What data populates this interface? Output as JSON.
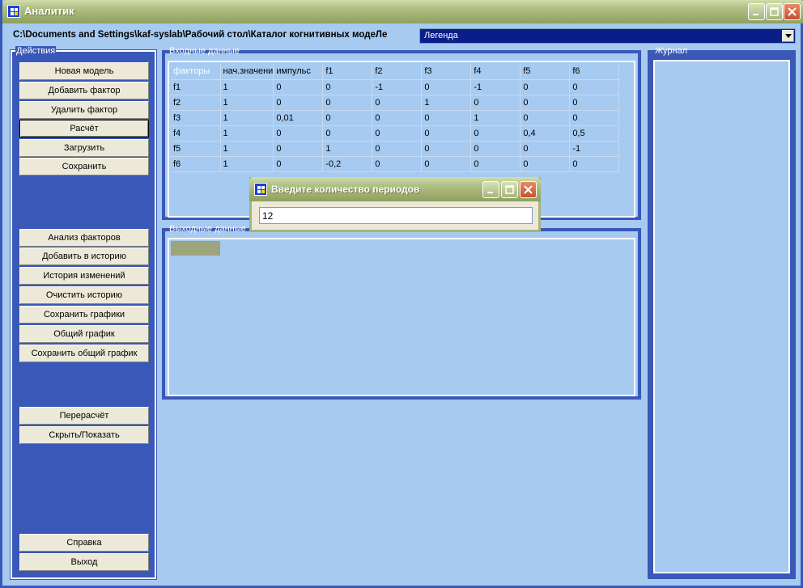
{
  "window": {
    "title": "Аналитик"
  },
  "path_bar": {
    "path": "C:\\Documents and Settings\\kaf-syslab\\Рабочий стол\\Каталог когнитивных модеЛе",
    "legend_value": "Легенда"
  },
  "actions": {
    "label": "Действия",
    "buttons": [
      "Новая модель",
      "Добавить фактор",
      "Удалить фактор",
      "Расчёт",
      "Загрузить",
      "Сохранить",
      "Анализ факторов",
      "Добавить в историю",
      "История изменений",
      "Очистить историю",
      "Сохранить графики",
      "Общий график",
      "Сохранить общий график",
      "Перерасчёт",
      "Скрыть/Показать",
      "Справка",
      "Выход"
    ]
  },
  "input_data": {
    "label": "Входные данные",
    "headers": [
      "факторы",
      "нач.значени",
      "импульс",
      "f1",
      "f2",
      "f3",
      "f4",
      "f5",
      "f6"
    ],
    "rows": [
      [
        "f1",
        "1",
        "0",
        "0",
        "-1",
        "0",
        "-1",
        "0",
        "0"
      ],
      [
        "f2",
        "1",
        "0",
        "0",
        "0",
        "1",
        "0",
        "0",
        "0"
      ],
      [
        "f3",
        "1",
        "0,01",
        "0",
        "0",
        "0",
        "1",
        "0",
        "0"
      ],
      [
        "f4",
        "1",
        "0",
        "0",
        "0",
        "0",
        "0",
        "0,4",
        "0,5"
      ],
      [
        "f5",
        "1",
        "0",
        "1",
        "0",
        "0",
        "0",
        "0",
        "-1"
      ],
      [
        "f6",
        "1",
        "0",
        "-0,2",
        "0",
        "0",
        "0",
        "0",
        "0"
      ]
    ]
  },
  "output_data": {
    "label": "Выходные данные"
  },
  "journal": {
    "label": "Журнал"
  },
  "dialog": {
    "title": "Введите количество периодов",
    "input_value": "12"
  },
  "colors": {
    "frame_blue": "#3a58b8",
    "panel_light_blue": "#a6caf0",
    "titlebar_olive": "#9eaf6e",
    "button_face": "#ece9d8",
    "combo_navy": "#0a1e8a"
  }
}
